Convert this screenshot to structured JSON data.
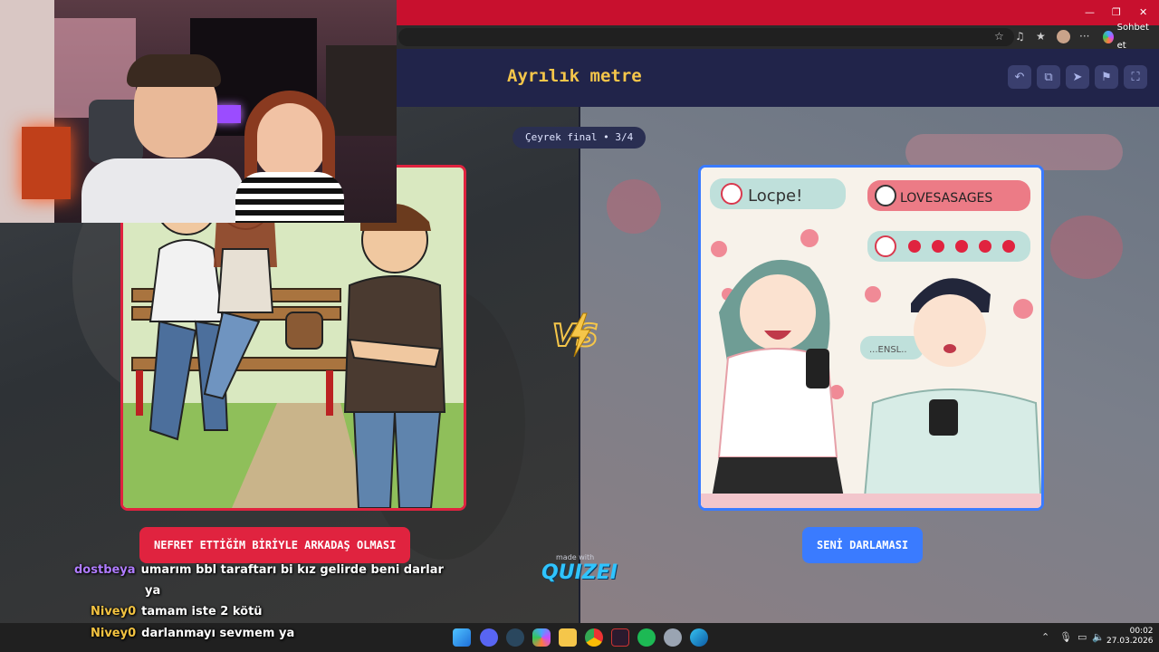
{
  "browser": {
    "sidebar_chat_label": "Sohbet et",
    "controls": [
      "—",
      "❐",
      "✕"
    ]
  },
  "quiz": {
    "title": "Ayrılık metre",
    "stage": "Çeyrek final • 3/4",
    "toolbar_icons": [
      "undo-icon",
      "share-icon",
      "send-icon",
      "flag-icon",
      "fullscreen-icon"
    ],
    "left_option": {
      "label": "NEFRET ETTİĞİM BİRİYLE ARKADAŞ OLMASI",
      "accent": "#e0233f"
    },
    "right_option": {
      "label": "SENİ DARLAMASI",
      "accent": "#3a7bff",
      "bubble_texts": [
        "Locpe!",
        "LOVESASAGES",
        "...ENSL.."
      ]
    },
    "vs_text": "VS",
    "made_with": "made with",
    "brand": "QUIZEI"
  },
  "chat": [
    {
      "user": "dostbeya",
      "color": "#b07cff",
      "message": "umarım bbl taraftarı bi kız gelirde beni darlar",
      "message_cont": "ya"
    },
    {
      "user": "Nivey0",
      "color": "#f3c341",
      "message": "tamam iste 2 kötü"
    },
    {
      "user": "Nivey0",
      "color": "#f3c341",
      "message": "darlanmayı sevmem ya"
    }
  ],
  "taskbar": {
    "time": "00:02",
    "date": "27.03.2026",
    "apps": [
      "windows-start-icon",
      "discord-icon",
      "steam-icon",
      "copilot-icon",
      "folder-icon",
      "chrome-icon",
      "app-icon",
      "spotify-icon",
      "settings-icon",
      "edge-icon"
    ]
  }
}
